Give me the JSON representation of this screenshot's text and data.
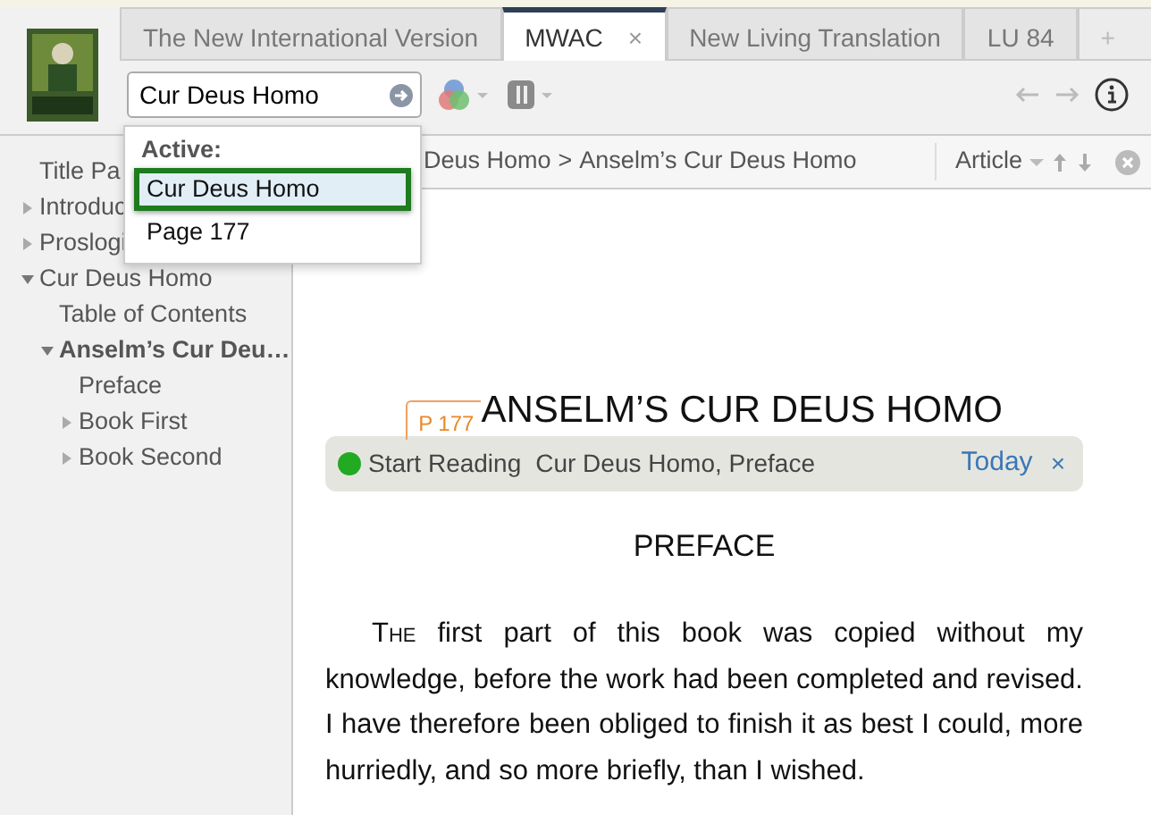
{
  "tabs": [
    {
      "label": "The New International Version",
      "selected": false,
      "closable": false
    },
    {
      "label": "MWAC",
      "selected": true,
      "closable": true,
      "close": "×"
    },
    {
      "label": "New Living Translation",
      "selected": false,
      "closable": false
    },
    {
      "label": "LU 84",
      "selected": false,
      "closable": false
    }
  ],
  "add_tab": "+",
  "search": {
    "value": "Cur Deus Homo"
  },
  "dropdown": {
    "heading": "Active:",
    "items": [
      {
        "label": "Cur Deus Homo",
        "selected": true
      },
      {
        "label": "Page 177",
        "selected": false
      }
    ]
  },
  "sidebar": {
    "items": [
      {
        "label": "Title Pa",
        "kind": "leaf"
      },
      {
        "label": "Introduc",
        "kind": "branch",
        "expanded": false
      },
      {
        "label": "Proslogi",
        "kind": "branch",
        "expanded": false
      },
      {
        "label": "Cur Deus Homo",
        "kind": "branch",
        "expanded": true,
        "children": [
          {
            "label": "Table of Contents",
            "kind": "leaf"
          },
          {
            "label": "Anselm’s Cur Deu…",
            "kind": "branch",
            "expanded": true,
            "bold": true,
            "children": [
              {
                "label": "Preface",
                "kind": "leaf"
              },
              {
                "label": "Book First",
                "kind": "branch",
                "expanded": false
              },
              {
                "label": "Book Second",
                "kind": "branch",
                "expanded": false
              }
            ]
          }
        ]
      }
    ]
  },
  "breadcrumb": {
    "items": [
      "Deus Homo",
      "Anselm’s Cur Deus Homo"
    ],
    "separator": ">"
  },
  "view_menu": "Article",
  "document": {
    "page_marker": "P 177",
    "title": "ANSELM’S CUR DEUS HOMO",
    "reading_banner": {
      "color": "#22aa22",
      "label": "Start Reading",
      "text": "Cur Deus Homo, Preface",
      "date": "Today",
      "close": "×"
    },
    "section": "PREFACE",
    "paragraph": {
      "lead_word": "The",
      "text": "first part of this book was copied without my knowledge, before the work had been completed and revised. I have therefore been obliged to finish it as best I could, more hurriedly, and so more briefly, than I wished."
    }
  }
}
